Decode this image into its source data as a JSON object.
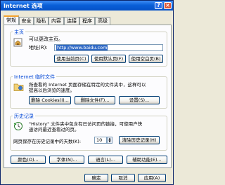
{
  "window": {
    "title": "Internet 选项",
    "help": "?",
    "close": "×"
  },
  "tabs": [
    {
      "label": "常规",
      "active": true
    },
    {
      "label": "安全"
    },
    {
      "label": "隐私"
    },
    {
      "label": "内容"
    },
    {
      "label": "连接"
    },
    {
      "label": "程序"
    },
    {
      "label": "高级"
    }
  ],
  "homepage": {
    "group_title": "主页",
    "description": "可以更改主页。",
    "address_label": "地址(R):",
    "address_value": "http://www.baidu.com",
    "buttons": {
      "current": "使用当前页(C)",
      "default": "使用默认页(F)",
      "blank": "使用空白页(B)"
    }
  },
  "temp_files": {
    "group_title": "Internet 临时文件",
    "description_line1": "所查看的 Internet 页面存储在特定的文件夹中，这样可以",
    "description_line2": "提高以后浏览的速度。",
    "buttons": {
      "cookies": "删除 Cookies(I)...",
      "files": "删除文件(F)...",
      "settings": "设置(S)..."
    }
  },
  "history": {
    "group_title": "历史记录",
    "description_line1": "\"History\" 文件夹中包含有已访问页的链接，可使用户快",
    "description_line2": "速访问最近查看过的页。",
    "days_label": "网页保存在历史记录中的天数(K):",
    "days_value": "10",
    "clear_button": "清除历史记录(H)"
  },
  "appearance_buttons": {
    "colors": "颜色(O)...",
    "fonts": "字体(N)...",
    "languages": "语言(L)...",
    "accessibility": "辅助功能(E)..."
  },
  "dialog_buttons": {
    "ok": "确定",
    "cancel": "取消",
    "apply": "应用(A)"
  }
}
